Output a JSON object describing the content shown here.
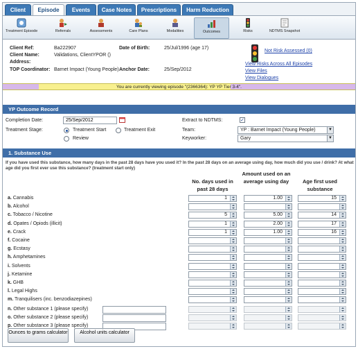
{
  "tabs": [
    {
      "label": "Client"
    },
    {
      "label": "Episode"
    },
    {
      "label": "Events"
    },
    {
      "label": "Case Notes"
    },
    {
      "label": "Prescriptions"
    },
    {
      "label": "Harm Reduction"
    }
  ],
  "toolbar": [
    {
      "label": "Treatment Episode",
      "icon": "treatment-episode-icon"
    },
    {
      "label": "Referrals",
      "icon": "referrals-icon"
    },
    {
      "label": "Assessments",
      "icon": "assessments-icon"
    },
    {
      "label": "Care Plans",
      "icon": "care-plans-icon"
    },
    {
      "label": "Modalities",
      "icon": "modalities-icon"
    },
    {
      "label": "Outcomes",
      "icon": "outcomes-icon"
    },
    {
      "label": "Risks",
      "icon": "risks-icon"
    },
    {
      "label": "NDTMS Snapshot",
      "icon": "ndtms-snapshot-icon"
    }
  ],
  "client": {
    "ref_label": "Client Ref:",
    "ref": "Ba222907",
    "name_label": "Client Name:",
    "name": "Validations, ClientYPOR ()",
    "address_label": "Address:",
    "dob_label": "Date of Birth:",
    "dob": "25/Jul/1996 (age 17)",
    "top_label": "TOP Coordinator:",
    "top": "Barnet Impact (Young People)",
    "anchor_label": "Anchor Date:",
    "anchor": "25/Sep/2012",
    "risk_status": "Not Risk Assessed (0)",
    "links": [
      "View Risks Across All Episodes",
      "View Files",
      "View Dialogues"
    ]
  },
  "notice": "You are currently viewing episode \"(2366364): YP YP Tier 3-4\".",
  "record": {
    "title": "YP Outcome Record",
    "completion_label": "Completion Date:",
    "completion_value": "25/Sep/2012",
    "stage_label": "Treatment Stage:",
    "stage_options": [
      "Treatment Start",
      "Treatment Exit",
      "Review"
    ],
    "stage_selected": "Treatment Start",
    "extract_label": "Extract to NDTMS:",
    "extract_checked": true,
    "team_label": "Team:",
    "team_value": "YP : Barnet Impact (Young People)",
    "keyworker_label": "Keyworker:",
    "keyworker_value": "Gary"
  },
  "substance": {
    "title": "1. Substance Use",
    "question": "If you have used this substance, how many days in the past 28 days have you used it? In the past 28 days on an average using day, how much did you use / drink? At what age did you first ever use this substance? (treatment start only)",
    "col_days": "No. days used in past 28 days",
    "col_amount": "Amount used on an average using day",
    "col_age": "Age first used substance",
    "rows": [
      {
        "letter": "a.",
        "name": "Cannabis",
        "days": "1",
        "amount": "1.00",
        "age": "15"
      },
      {
        "letter": "b.",
        "name": "Alcohol",
        "days": "",
        "amount": "",
        "age": ""
      },
      {
        "letter": "c.",
        "name": "Tobacco / Nicotine",
        "days": "5",
        "amount": "5.00",
        "age": "14"
      },
      {
        "letter": "d.",
        "name": "Opates / Opiods (illicit)",
        "days": "1",
        "amount": "2.00",
        "age": "17"
      },
      {
        "letter": "e.",
        "name": "Crack",
        "days": "1",
        "amount": "1.00",
        "age": "16"
      },
      {
        "letter": "f.",
        "name": "Cocaine",
        "days": "",
        "amount": "",
        "age": ""
      },
      {
        "letter": "g.",
        "name": "Ecstasy",
        "days": "",
        "amount": "",
        "age": ""
      },
      {
        "letter": "h.",
        "name": "Amphetamines",
        "days": "",
        "amount": "",
        "age": ""
      },
      {
        "letter": "i.",
        "name": "Solvents",
        "days": "",
        "amount": "",
        "age": ""
      },
      {
        "letter": "j.",
        "name": "Ketamine",
        "days": "",
        "amount": "",
        "age": ""
      },
      {
        "letter": "k.",
        "name": "GHB",
        "days": "",
        "amount": "",
        "age": ""
      },
      {
        "letter": "l.",
        "name": "Legal Highs",
        "days": "",
        "amount": "",
        "age": ""
      },
      {
        "letter": "m.",
        "name": "Tranquilisers (inc. benzodiazepines)",
        "days": "",
        "amount": "",
        "age": ""
      }
    ],
    "other_rows": [
      {
        "letter": "n.",
        "name": "Other substance 1 (please specify)"
      },
      {
        "letter": "o.",
        "name": "Other substance 2 (please specify)"
      },
      {
        "letter": "p.",
        "name": "Other substance 3 (please specify)"
      }
    ]
  },
  "buttons": {
    "ounces": "Ounces to grams calculator",
    "alcohol": "Alcohol units calculator"
  }
}
